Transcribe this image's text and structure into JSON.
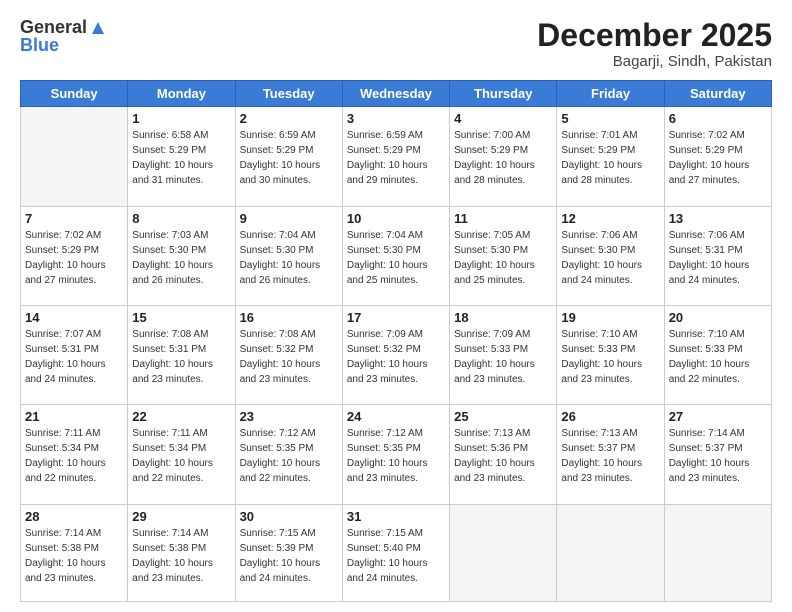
{
  "logo": {
    "general": "General",
    "blue": "Blue"
  },
  "title": "December 2025",
  "location": "Bagarji, Sindh, Pakistan",
  "days_of_week": [
    "Sunday",
    "Monday",
    "Tuesday",
    "Wednesday",
    "Thursday",
    "Friday",
    "Saturday"
  ],
  "weeks": [
    [
      {
        "day": "",
        "sunrise": "",
        "sunset": "",
        "daylight": ""
      },
      {
        "day": "1",
        "sunrise": "Sunrise: 6:58 AM",
        "sunset": "Sunset: 5:29 PM",
        "daylight": "Daylight: 10 hours and 31 minutes."
      },
      {
        "day": "2",
        "sunrise": "Sunrise: 6:59 AM",
        "sunset": "Sunset: 5:29 PM",
        "daylight": "Daylight: 10 hours and 30 minutes."
      },
      {
        "day": "3",
        "sunrise": "Sunrise: 6:59 AM",
        "sunset": "Sunset: 5:29 PM",
        "daylight": "Daylight: 10 hours and 29 minutes."
      },
      {
        "day": "4",
        "sunrise": "Sunrise: 7:00 AM",
        "sunset": "Sunset: 5:29 PM",
        "daylight": "Daylight: 10 hours and 28 minutes."
      },
      {
        "day": "5",
        "sunrise": "Sunrise: 7:01 AM",
        "sunset": "Sunset: 5:29 PM",
        "daylight": "Daylight: 10 hours and 28 minutes."
      },
      {
        "day": "6",
        "sunrise": "Sunrise: 7:02 AM",
        "sunset": "Sunset: 5:29 PM",
        "daylight": "Daylight: 10 hours and 27 minutes."
      }
    ],
    [
      {
        "day": "7",
        "sunrise": "Sunrise: 7:02 AM",
        "sunset": "Sunset: 5:29 PM",
        "daylight": "Daylight: 10 hours and 27 minutes."
      },
      {
        "day": "8",
        "sunrise": "Sunrise: 7:03 AM",
        "sunset": "Sunset: 5:30 PM",
        "daylight": "Daylight: 10 hours and 26 minutes."
      },
      {
        "day": "9",
        "sunrise": "Sunrise: 7:04 AM",
        "sunset": "Sunset: 5:30 PM",
        "daylight": "Daylight: 10 hours and 26 minutes."
      },
      {
        "day": "10",
        "sunrise": "Sunrise: 7:04 AM",
        "sunset": "Sunset: 5:30 PM",
        "daylight": "Daylight: 10 hours and 25 minutes."
      },
      {
        "day": "11",
        "sunrise": "Sunrise: 7:05 AM",
        "sunset": "Sunset: 5:30 PM",
        "daylight": "Daylight: 10 hours and 25 minutes."
      },
      {
        "day": "12",
        "sunrise": "Sunrise: 7:06 AM",
        "sunset": "Sunset: 5:30 PM",
        "daylight": "Daylight: 10 hours and 24 minutes."
      },
      {
        "day": "13",
        "sunrise": "Sunrise: 7:06 AM",
        "sunset": "Sunset: 5:31 PM",
        "daylight": "Daylight: 10 hours and 24 minutes."
      }
    ],
    [
      {
        "day": "14",
        "sunrise": "Sunrise: 7:07 AM",
        "sunset": "Sunset: 5:31 PM",
        "daylight": "Daylight: 10 hours and 24 minutes."
      },
      {
        "day": "15",
        "sunrise": "Sunrise: 7:08 AM",
        "sunset": "Sunset: 5:31 PM",
        "daylight": "Daylight: 10 hours and 23 minutes."
      },
      {
        "day": "16",
        "sunrise": "Sunrise: 7:08 AM",
        "sunset": "Sunset: 5:32 PM",
        "daylight": "Daylight: 10 hours and 23 minutes."
      },
      {
        "day": "17",
        "sunrise": "Sunrise: 7:09 AM",
        "sunset": "Sunset: 5:32 PM",
        "daylight": "Daylight: 10 hours and 23 minutes."
      },
      {
        "day": "18",
        "sunrise": "Sunrise: 7:09 AM",
        "sunset": "Sunset: 5:33 PM",
        "daylight": "Daylight: 10 hours and 23 minutes."
      },
      {
        "day": "19",
        "sunrise": "Sunrise: 7:10 AM",
        "sunset": "Sunset: 5:33 PM",
        "daylight": "Daylight: 10 hours and 23 minutes."
      },
      {
        "day": "20",
        "sunrise": "Sunrise: 7:10 AM",
        "sunset": "Sunset: 5:33 PM",
        "daylight": "Daylight: 10 hours and 22 minutes."
      }
    ],
    [
      {
        "day": "21",
        "sunrise": "Sunrise: 7:11 AM",
        "sunset": "Sunset: 5:34 PM",
        "daylight": "Daylight: 10 hours and 22 minutes."
      },
      {
        "day": "22",
        "sunrise": "Sunrise: 7:11 AM",
        "sunset": "Sunset: 5:34 PM",
        "daylight": "Daylight: 10 hours and 22 minutes."
      },
      {
        "day": "23",
        "sunrise": "Sunrise: 7:12 AM",
        "sunset": "Sunset: 5:35 PM",
        "daylight": "Daylight: 10 hours and 22 minutes."
      },
      {
        "day": "24",
        "sunrise": "Sunrise: 7:12 AM",
        "sunset": "Sunset: 5:35 PM",
        "daylight": "Daylight: 10 hours and 23 minutes."
      },
      {
        "day": "25",
        "sunrise": "Sunrise: 7:13 AM",
        "sunset": "Sunset: 5:36 PM",
        "daylight": "Daylight: 10 hours and 23 minutes."
      },
      {
        "day": "26",
        "sunrise": "Sunrise: 7:13 AM",
        "sunset": "Sunset: 5:37 PM",
        "daylight": "Daylight: 10 hours and 23 minutes."
      },
      {
        "day": "27",
        "sunrise": "Sunrise: 7:14 AM",
        "sunset": "Sunset: 5:37 PM",
        "daylight": "Daylight: 10 hours and 23 minutes."
      }
    ],
    [
      {
        "day": "28",
        "sunrise": "Sunrise: 7:14 AM",
        "sunset": "Sunset: 5:38 PM",
        "daylight": "Daylight: 10 hours and 23 minutes."
      },
      {
        "day": "29",
        "sunrise": "Sunrise: 7:14 AM",
        "sunset": "Sunset: 5:38 PM",
        "daylight": "Daylight: 10 hours and 23 minutes."
      },
      {
        "day": "30",
        "sunrise": "Sunrise: 7:15 AM",
        "sunset": "Sunset: 5:39 PM",
        "daylight": "Daylight: 10 hours and 24 minutes."
      },
      {
        "day": "31",
        "sunrise": "Sunrise: 7:15 AM",
        "sunset": "Sunset: 5:40 PM",
        "daylight": "Daylight: 10 hours and 24 minutes."
      },
      {
        "day": "",
        "sunrise": "",
        "sunset": "",
        "daylight": ""
      },
      {
        "day": "",
        "sunrise": "",
        "sunset": "",
        "daylight": ""
      },
      {
        "day": "",
        "sunrise": "",
        "sunset": "",
        "daylight": ""
      }
    ]
  ]
}
